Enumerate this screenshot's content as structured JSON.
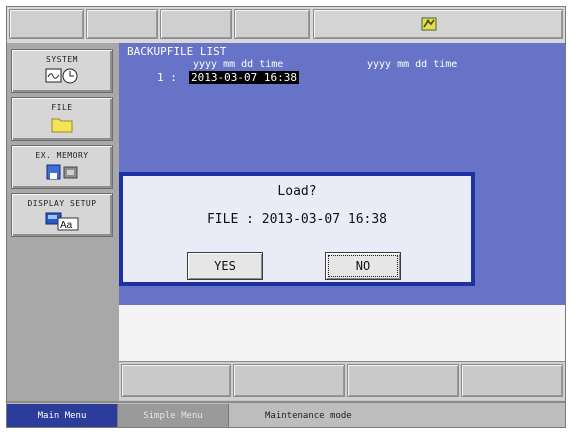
{
  "menu": {
    "system_label": "SYSTEM",
    "file_label": "FILE",
    "ex_memory_label": "EX. MEMORY",
    "display_setup_label": "DISPLAY SETUP"
  },
  "panel": {
    "title": "BACKUPFILE LIST",
    "col_header_1": "yyyy mm dd  time",
    "col_header_2": "yyyy mm dd  time",
    "rows": [
      {
        "index": "1 :",
        "value": "2013-03-07 16:38"
      }
    ]
  },
  "dialog": {
    "title": "Load?",
    "message": "FILE : 2013-03-07 16:38",
    "yes_label": "YES",
    "no_label": "NO"
  },
  "bottom": {
    "main_menu_label": "Main Menu",
    "simple_menu_label": "Simple Menu",
    "status_text": "Maintenance mode"
  },
  "colors": {
    "main_area": "#6673c6",
    "dialog_border": "#1d30a4",
    "main_menu_bg": "#2c3c9a"
  },
  "icons": [
    "robot-status-icon",
    "system-icon",
    "folder-icon",
    "memory-card-icon",
    "display-setup-icon"
  ]
}
